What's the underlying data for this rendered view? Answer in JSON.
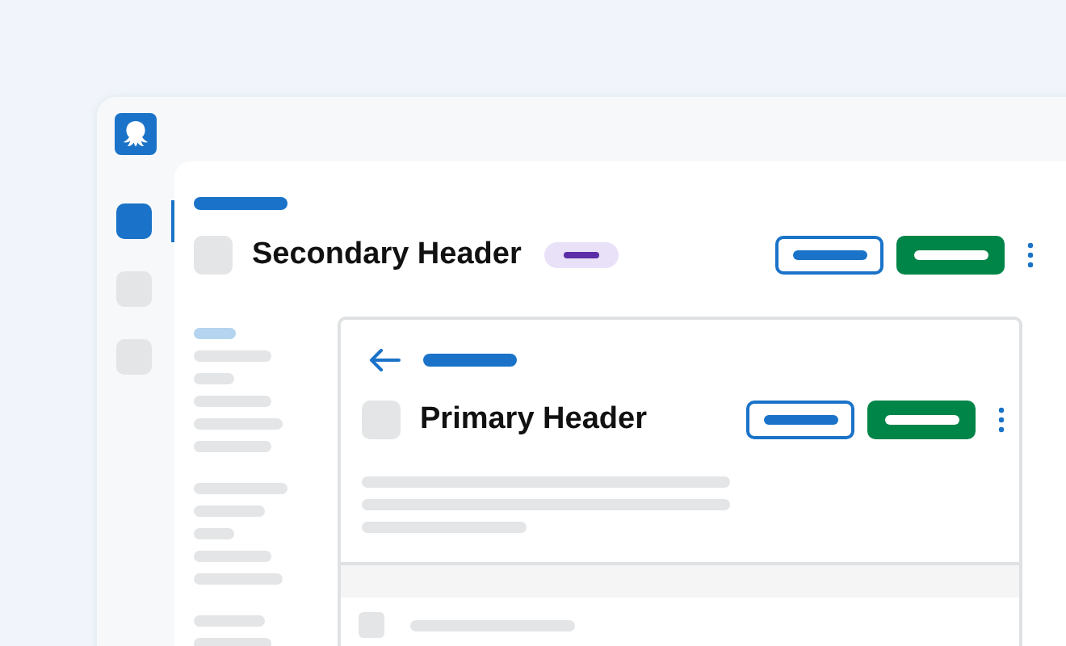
{
  "nav": [
    {
      "selected": true
    },
    {
      "selected": false
    },
    {
      "selected": false
    }
  ],
  "secondary_header": {
    "title": "Secondary Header"
  },
  "subnav": [
    [
      {
        "selected": true
      },
      {
        "selected": false
      },
      {
        "selected": false
      },
      {
        "selected": false
      },
      {
        "selected": false
      },
      {
        "selected": false
      }
    ],
    [
      {
        "selected": false
      },
      {
        "selected": false
      },
      {
        "selected": false
      },
      {
        "selected": false
      },
      {
        "selected": false
      }
    ],
    [
      {
        "selected": false
      },
      {
        "selected": false
      }
    ]
  ],
  "primary_header": {
    "title": "Primary Header"
  }
}
